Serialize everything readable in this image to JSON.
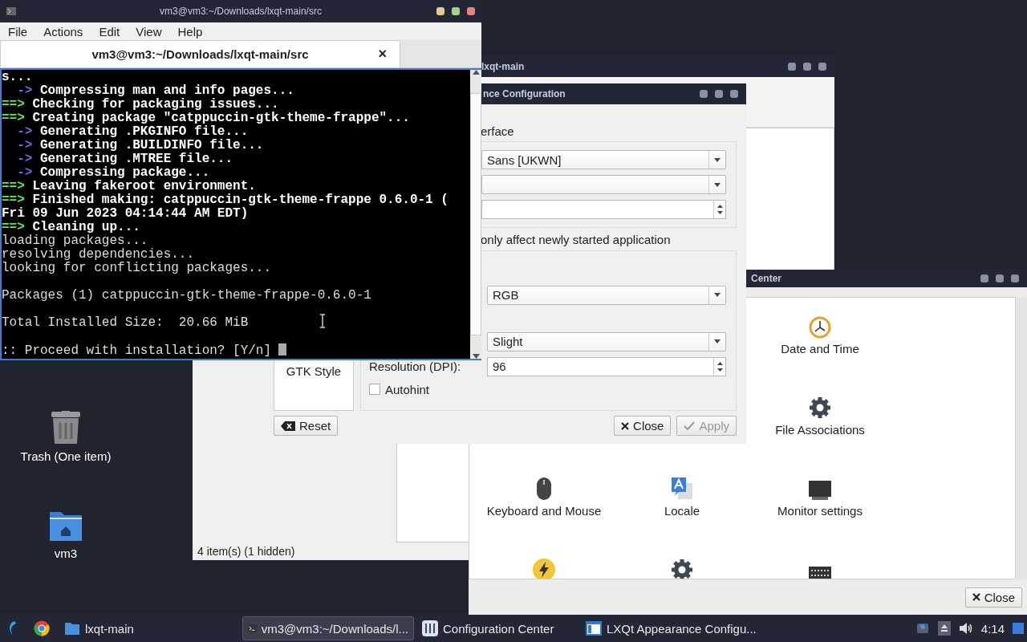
{
  "desktop": {
    "icons": [
      {
        "label": "Trash (One item)",
        "kind": "trash"
      },
      {
        "label": "vm3",
        "kind": "home-folder"
      }
    ]
  },
  "file_manager": {
    "title": "lxqt-main",
    "status": "4 item(s) (1 hidden)"
  },
  "config_center": {
    "title": "Center",
    "rows": [
      {
        "items": [
          {
            "label": "Date and Time",
            "kind": "clock"
          }
        ]
      },
      {
        "items": [
          {
            "label": "File Associations",
            "kind": "gear"
          }
        ]
      },
      {
        "items": [
          {
            "label": "Keyboard and Mouse",
            "kind": "mouse"
          },
          {
            "label": "Locale",
            "kind": "translate"
          },
          {
            "label": "Monitor settings",
            "kind": "monitor"
          }
        ]
      },
      {
        "items": [
          {
            "kind": "power"
          },
          {
            "kind": "gear"
          },
          {
            "kind": "keyboard"
          }
        ]
      }
    ],
    "close_button": "Close"
  },
  "appearance": {
    "title": "nce Configuration",
    "sidebar": [
      {
        "label": "GTK Style",
        "selected": false
      }
    ],
    "heading": "erface",
    "font_combo": "Sans [UKWN]",
    "note": "only affect newly started application",
    "subpixel": "RGB",
    "hinting": "Slight",
    "dpi_label": "Resolution (DPI):",
    "dpi": "96",
    "autohint": {
      "label": "Autohint",
      "checked": false
    },
    "reset_button": "Reset",
    "close_button": "Close",
    "apply_button": {
      "label": "Apply",
      "disabled": true
    }
  },
  "terminal": {
    "title": "vm3@vm3:~/Downloads/lxqt-main/src",
    "menu": [
      "File",
      "Actions",
      "Edit",
      "View",
      "Help"
    ],
    "tab": {
      "label": "vm3@vm3:~/Downloads/lxqt-main/src",
      "close": "×"
    },
    "lines": [
      {
        "kind": "bold",
        "text": "s..."
      },
      {
        "kind": "step",
        "prefix": "  ->",
        "text": " Compressing man and info pages..."
      },
      {
        "kind": "stage",
        "prefix": "==>",
        "text": " Checking for packaging issues..."
      },
      {
        "kind": "stage",
        "prefix": "==>",
        "text": " Creating package \"catppuccin-gtk-theme-frappe\"..."
      },
      {
        "kind": "step",
        "prefix": "  ->",
        "text": " Generating .PKGINFO file..."
      },
      {
        "kind": "step",
        "prefix": "  ->",
        "text": " Generating .BUILDINFO file..."
      },
      {
        "kind": "step",
        "prefix": "  ->",
        "text": " Generating .MTREE file..."
      },
      {
        "kind": "step",
        "prefix": "  ->",
        "text": " Compressing package..."
      },
      {
        "kind": "stage",
        "prefix": "==>",
        "text": " Leaving fakeroot environment."
      },
      {
        "kind": "stage",
        "prefix": "==>",
        "text": " Finished making: catppuccin-gtk-theme-frappe 0.6.0-1 ("
      },
      {
        "kind": "bold",
        "text": "Fri 09 Jun 2023 04:14:44 AM EDT)"
      },
      {
        "kind": "stage",
        "prefix": "==>",
        "text": " Cleaning up..."
      },
      {
        "kind": "plain",
        "text": "loading packages..."
      },
      {
        "kind": "plain",
        "text": "resolving dependencies..."
      },
      {
        "kind": "plain",
        "text": "looking for conflicting packages..."
      },
      {
        "kind": "blank"
      },
      {
        "kind": "plain",
        "text": "Packages (1) catppuccin-gtk-theme-frappe-0.6.0-1"
      },
      {
        "kind": "blank"
      },
      {
        "kind": "plain",
        "text": "Total Installed Size:  20.66 MiB"
      },
      {
        "kind": "blank"
      },
      {
        "kind": "prompt",
        "text": ":: Proceed with installation? [Y/n]"
      }
    ]
  },
  "taskbar": {
    "items": [
      {
        "kind": "folder",
        "label": "lxqt-main",
        "selected": false
      },
      {
        "kind": "terminal",
        "label": "vm3@vm3:~/Downloads/l...",
        "selected": true
      },
      {
        "kind": "config",
        "label": "Configuration Center",
        "selected": false
      },
      {
        "kind": "appearance",
        "label": "LXQt Appearance Configu...",
        "selected": false
      }
    ],
    "clock": "4:14"
  }
}
